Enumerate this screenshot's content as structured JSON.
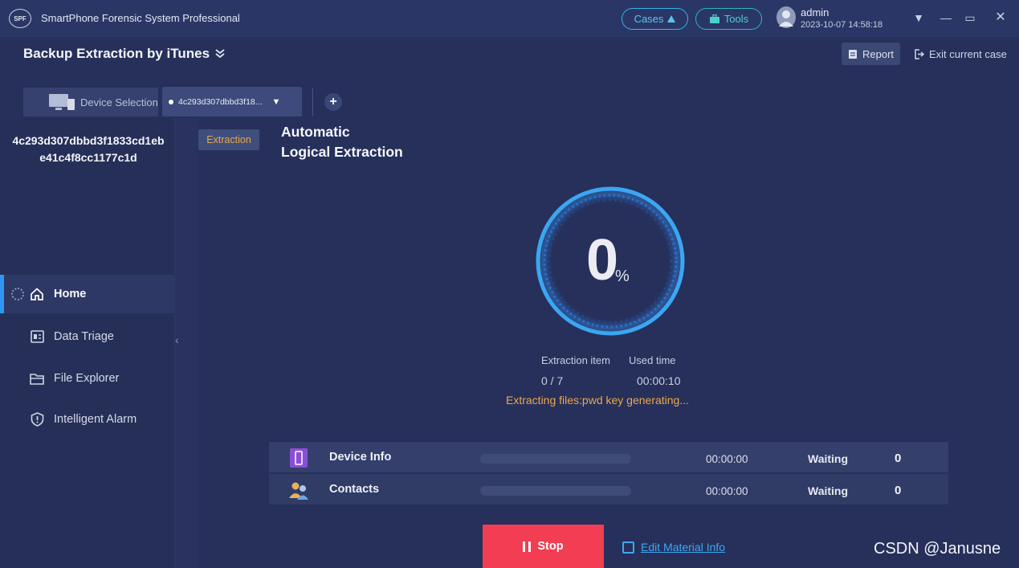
{
  "app": {
    "logo": "SPF",
    "title": "SmartPhone Forensic System Professional"
  },
  "topbar": {
    "cases_label": "Cases",
    "tools_label": "Tools",
    "user_name": "admin",
    "user_time": "2023-10-07 14:58:18"
  },
  "header": {
    "title": "Backup Extraction by iTunes",
    "report_label": "Report",
    "exit_label": "Exit current case"
  },
  "tabs": {
    "device_selection_label": "Device Selection",
    "active_tab_label": "4c293d307dbbd3f18..."
  },
  "sidebar": {
    "device_id": "4c293d307dbbd3f1833cd1ebe41c4f8cc1177c1d",
    "items": [
      {
        "label": "Home",
        "icon": "home-icon"
      },
      {
        "label": "Data Triage",
        "icon": "data-triage-icon"
      },
      {
        "label": "File Explorer",
        "icon": "folder-icon"
      },
      {
        "label": "Intelligent Alarm",
        "icon": "shield-alert-icon"
      }
    ]
  },
  "main": {
    "badge": "Extraction",
    "title_line1": "Automatic",
    "title_line2": "Logical Extraction",
    "progress_value": "0",
    "progress_unit": "%",
    "extraction_item_label": "Extraction item",
    "extraction_item_value": "0 / 7",
    "used_time_label": "Used time",
    "used_time_value": "00:00:10",
    "status_text": "Extracting files:pwd key generating..."
  },
  "tasks": [
    {
      "name": "Device Info",
      "icon": "phone-icon",
      "progress": 0,
      "time": "00:00:00",
      "status": "Waiting",
      "count": "0"
    },
    {
      "name": "Contacts",
      "icon": "contacts-icon",
      "progress": 0,
      "time": "00:00:00",
      "status": "Waiting",
      "count": "0"
    }
  ],
  "footer": {
    "stop_label": "Stop",
    "edit_label": "Edit Material Info"
  },
  "watermark": "CSDN @Janusne",
  "colors": {
    "accent_blue": "#2f97f1",
    "stop_red": "#f23d52",
    "status_orange": "#eca84a"
  }
}
